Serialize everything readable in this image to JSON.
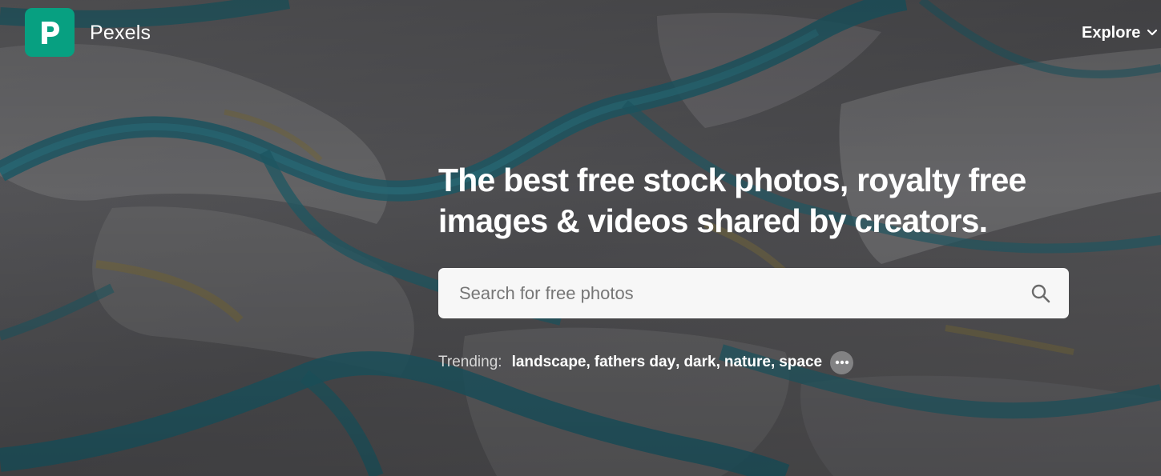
{
  "header": {
    "brand": "Pexels",
    "logo_letter": "P",
    "explore_label": "Explore"
  },
  "hero": {
    "headline": "The best free stock photos, royalty free images & videos shared by creators."
  },
  "search": {
    "placeholder": "Search for free photos",
    "value": ""
  },
  "trending": {
    "label": "Trending:",
    "tags": [
      "landscape",
      "fathers day",
      "dark",
      "nature",
      "space"
    ]
  },
  "icons": {
    "logo": "pexels-logo-icon",
    "explore": "chevron-down-icon",
    "search": "search-icon",
    "more": "more-dots-icon"
  },
  "colors": {
    "brand": "#07a081",
    "river": "#1e5a66",
    "terrain": "#5a5a5c",
    "search_bg": "#f7f7f7"
  }
}
